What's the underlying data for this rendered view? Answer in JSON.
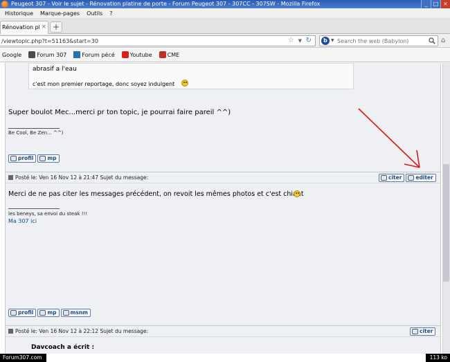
{
  "window": {
    "title": "Peugeot 307 - Voir le sujet - Rénovation platine de porte - Forum Peugeot 307 - 307CC - 307SW - Mozilla Firefox",
    "controls": [
      "_",
      "□",
      "×"
    ]
  },
  "menu": [
    "Historique",
    "Marque-pages",
    "Outils",
    "?"
  ],
  "tab": {
    "label": "Rénovation plat...",
    "close": "×",
    "new_tab": "+"
  },
  "nav": {
    "url": "/viewtopic.php?t=51163&start=30",
    "search_placeholder": "Search the web (Babylon)"
  },
  "bookmarks": [
    {
      "label": "Google",
      "icon": "google-icon",
      "color": "#ffffff"
    },
    {
      "label": "Forum 307",
      "icon": "lion-icon",
      "color": "#4a4a4a"
    },
    {
      "label": "Forum pécé",
      "icon": "forum-icon",
      "color": "#2a6fb0"
    },
    {
      "label": "Youtube",
      "icon": "youtube-icon",
      "color": "#d8201d"
    },
    {
      "label": "CME",
      "icon": "cme-icon",
      "color": "#c0302a"
    }
  ],
  "post_prev": {
    "quote_tail_1": "abrasif a l'eau",
    "quote_tail_2": "c'est mon premier reportage, donc soyez indulgent",
    "reply": "Super boulot Mec...merci pr ton topic, je pourrai faire pareil ^^)",
    "signature": "Be Cool, Be Zen... ^^)",
    "buttons": [
      "profil",
      "mp"
    ]
  },
  "post_2": {
    "header": "Posté le: Ven 16 Nov 12 à 21:47     Sujet du message:",
    "actions": [
      "citer",
      "editer"
    ],
    "body": "Merci de ne pas citer les messages précédent, on revoit les mêmes photos et c'est chiant",
    "signature": "les beneys, sa envoi du steak !!!",
    "sig_link": "Ma 307 ici",
    "buttons": [
      "profil",
      "mp",
      "msnm"
    ]
  },
  "post_3": {
    "header": "Posté le: Ven 16 Nov 12 à 22:12     Sujet du message:",
    "actions": [
      "citer"
    ],
    "quote_author": "Davcoach a écrit :"
  },
  "status": {
    "left": "Forum307.com",
    "right": "113 ko"
  },
  "colors": {
    "annotation_arrow": "#e01818",
    "forum_background": "#eef0f3",
    "link": "#0a4c9c"
  }
}
